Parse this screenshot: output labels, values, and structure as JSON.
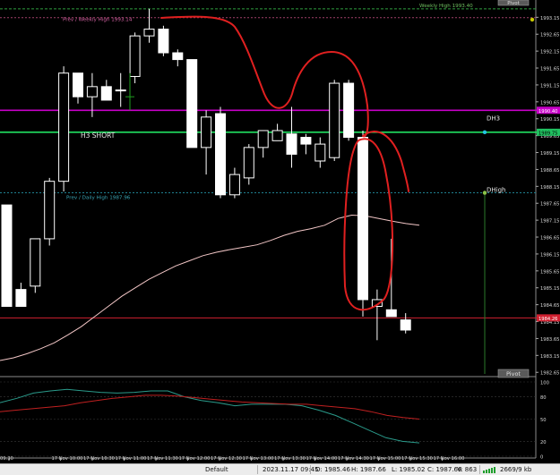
{
  "chart": {
    "price_labels": [
      "1993.15",
      "1992.65",
      "1992.15",
      "1991.65",
      "1991.15",
      "1990.65",
      "1990.15",
      "1989.65",
      "1989.15",
      "1988.65",
      "1988.15",
      "1987.65",
      "1987.15",
      "1986.65",
      "1986.15",
      "1985.65",
      "1985.15",
      "1984.65",
      "1984.15",
      "1983.65",
      "1983.15",
      "1982.65"
    ],
    "time_labels": [
      "09:30",
      "17 Nov 10:00",
      "17 Nov 10:30",
      "17 Nov 11:00",
      "17 Nov 11:30",
      "17 Nov 12:00",
      "17 Nov 12:30",
      "17 Nov 13:00",
      "17 Nov 13:30",
      "17 Nov 14:00",
      "17 Nov 14:30",
      "17 Nov 15:00",
      "17 Nov 15:30",
      "17 Nov 16:00"
    ],
    "osc_labels": [
      "100",
      "80",
      "50",
      "20",
      "0"
    ],
    "annotations": {
      "weekly_high_right": "Weekly High 1993.40",
      "prev_weekly_high": "Prev / Weekly High 1993.14",
      "h3_short": "H3 SHORT",
      "dh3": "DH3",
      "dhigh": "DHigh",
      "prev_daily_high": "Prev / Daily High 1987.96",
      "pivot": "Pivot"
    },
    "price_boxes": {
      "magenta": "1990.40",
      "green": "1989.75",
      "red": "1984.26"
    }
  },
  "chart_data": {
    "type": "candlestick",
    "title": "",
    "candles": [
      {
        "time": "10:00",
        "open": 1987.6,
        "high": 1987.6,
        "low": 1984.6,
        "close": 1984.6
      },
      {
        "time": "10:10",
        "open": 1985.1,
        "high": 1985.3,
        "low": 1984.6,
        "close": 1984.6
      },
      {
        "time": "10:20",
        "open": 1985.2,
        "high": 1986.6,
        "low": 1985.0,
        "close": 1986.6
      },
      {
        "time": "10:30",
        "open": 1986.6,
        "high": 1988.4,
        "low": 1986.4,
        "close": 1988.3
      },
      {
        "time": "10:40",
        "open": 1988.3,
        "high": 1991.7,
        "low": 1988.0,
        "close": 1991.5
      },
      {
        "time": "10:50",
        "open": 1991.5,
        "high": 1991.5,
        "low": 1990.6,
        "close": 1990.8
      },
      {
        "time": "11:00",
        "open": 1990.8,
        "high": 1991.5,
        "low": 1990.2,
        "close": 1991.1
      },
      {
        "time": "11:10",
        "open": 1991.1,
        "high": 1991.3,
        "low": 1990.7,
        "close": 1990.7
      },
      {
        "time": "11:20",
        "open": 1991.0,
        "high": 1991.5,
        "low": 1990.5,
        "close": 1991.0
      },
      {
        "time": "11:30",
        "open": 1991.4,
        "high": 1992.7,
        "low": 1991.2,
        "close": 1992.6
      },
      {
        "time": "11:40",
        "open": 1992.6,
        "high": 1993.4,
        "low": 1992.4,
        "close": 1992.8
      },
      {
        "time": "11:50",
        "open": 1992.8,
        "high": 1992.9,
        "low": 1992.0,
        "close": 1992.1
      },
      {
        "time": "12:00",
        "open": 1992.1,
        "high": 1992.2,
        "low": 1991.7,
        "close": 1991.9
      },
      {
        "time": "12:10",
        "open": 1991.9,
        "high": 1991.9,
        "low": 1989.3,
        "close": 1989.3
      },
      {
        "time": "12:20",
        "open": 1989.3,
        "high": 1990.4,
        "low": 1988.5,
        "close": 1990.2
      },
      {
        "time": "12:30",
        "open": 1990.3,
        "high": 1990.5,
        "low": 1987.8,
        "close": 1987.9
      },
      {
        "time": "12:40",
        "open": 1987.9,
        "high": 1988.7,
        "low": 1987.8,
        "close": 1988.5
      },
      {
        "time": "12:50",
        "open": 1988.4,
        "high": 1989.4,
        "low": 1988.2,
        "close": 1989.3
      },
      {
        "time": "13:00",
        "open": 1989.3,
        "high": 1989.8,
        "low": 1989.0,
        "close": 1989.8
      },
      {
        "time": "13:10",
        "open": 1989.5,
        "high": 1990.0,
        "low": 1989.5,
        "close": 1989.8
      },
      {
        "time": "13:20",
        "open": 1989.7,
        "high": 1990.5,
        "low": 1988.7,
        "close": 1989.1
      },
      {
        "time": "13:30",
        "open": 1989.6,
        "high": 1989.7,
        "low": 1989.1,
        "close": 1989.4
      },
      {
        "time": "13:40",
        "open": 1988.9,
        "high": 1989.6,
        "low": 1988.7,
        "close": 1989.4
      },
      {
        "time": "13:50",
        "open": 1989.0,
        "high": 1991.3,
        "low": 1988.9,
        "close": 1991.2
      },
      {
        "time": "14:00",
        "open": 1991.2,
        "high": 1991.3,
        "low": 1989.5,
        "close": 1989.6
      },
      {
        "time": "14:10",
        "open": 1989.6,
        "high": 1989.8,
        "low": 1984.3,
        "close": 1984.8
      },
      {
        "time": "14:20",
        "open": 1984.6,
        "high": 1985.1,
        "low": 1983.6,
        "close": 1984.8
      },
      {
        "time": "14:30",
        "open": 1984.5,
        "high": 1986.6,
        "low": 1984.3,
        "close": 1984.3
      },
      {
        "time": "14:40",
        "open": 1984.2,
        "high": 1984.4,
        "low": 1983.8,
        "close": 1983.9
      }
    ],
    "bullish_marker": {
      "time": "11:00",
      "open": 1990.8,
      "high": 1991.5,
      "low": 1990.4,
      "close": 1991.0
    },
    "moving_average": [
      1983.0,
      1983.08,
      1983.2,
      1983.35,
      1983.52,
      1983.75,
      1984.0,
      1984.3,
      1984.6,
      1984.9,
      1985.15,
      1985.4,
      1985.6,
      1985.8,
      1985.95,
      1986.1,
      1986.2,
      1986.28,
      1986.35,
      1986.42,
      1986.55,
      1986.7,
      1986.82,
      1986.9,
      1987.0,
      1987.2,
      1987.3,
      1987.28,
      1987.2,
      1987.12,
      1987.05,
      1987.0
    ],
    "levels": {
      "weekly_high": 1993.4,
      "prev_weekly_high": 1993.14,
      "dh3": 1990.4,
      "h3_short": 1989.75,
      "prev_daily_high": 1987.96,
      "low_red": 1984.26
    },
    "oscillator": {
      "levels": [
        0,
        20,
        50,
        80,
        100
      ],
      "series": [
        {
          "values": [
            72,
            78,
            85,
            88,
            90,
            88,
            86,
            85,
            86,
            88,
            88,
            80,
            75,
            72,
            68,
            70,
            70,
            70,
            68,
            62,
            55,
            45,
            35,
            25,
            20,
            18
          ]
        },
        {
          "values": [
            60,
            62,
            64,
            66,
            68,
            72,
            75,
            78,
            80,
            82,
            82,
            81,
            79,
            77,
            75,
            73,
            72,
            71,
            70,
            70,
            68,
            66,
            64,
            60,
            55,
            52,
            50
          ]
        }
      ]
    },
    "yrange": [
      1982.55,
      1993.45
    ]
  },
  "status": {
    "profile": "Default",
    "datetime": "2023.11.17 09:45",
    "open": "O: 1985.46",
    "high": "H: 1987.66",
    "low": "L: 1985.02",
    "close": "C: 1987.66",
    "volume": "V: 863",
    "traffic": "2669/9 kb"
  }
}
